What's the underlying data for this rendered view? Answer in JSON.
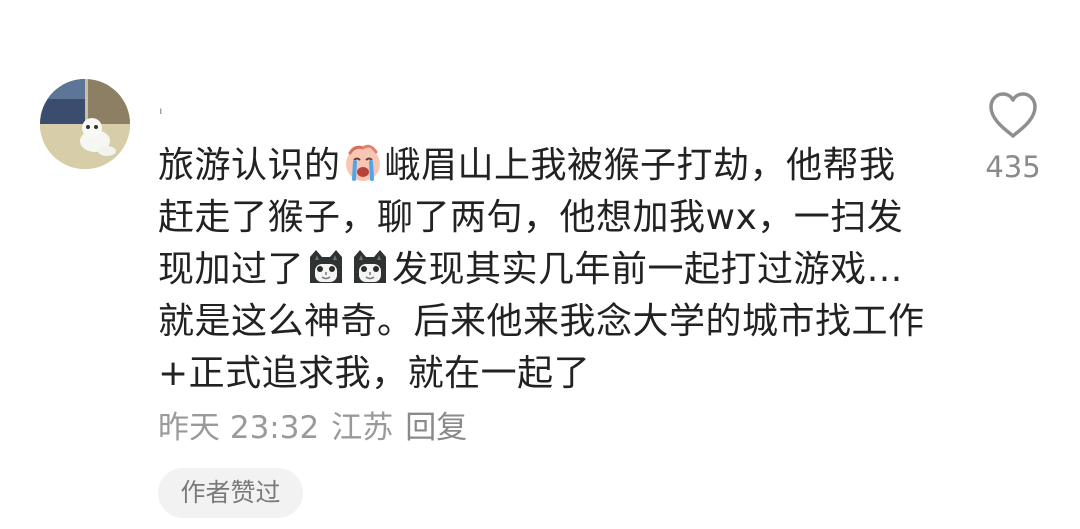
{
  "comment": {
    "username": "ˌ",
    "text_parts": [
      "旅游认识的",
      "峨眉山上我被猴子打劫，他帮我赶走了猴子，聊了两句，他想加我wx，一扫发现加过了",
      "发现其实几年前一起打过游戏…就是这么神奇。后来他来我念大学的城市找工作+正式追求我，就在一起了"
    ],
    "emojis": [
      "crying-face-emoji",
      "cat-emoji",
      "cat-emoji"
    ],
    "time": "昨天 23:32",
    "location": "江苏",
    "reply_label": "回复",
    "author_liked_label": "作者赞过",
    "like_count": "435"
  },
  "icons": {
    "like": "heart-outline-icon"
  },
  "colors": {
    "text": "#222222",
    "meta": "#9a9a9a",
    "pill_bg": "#f2f2f2"
  }
}
